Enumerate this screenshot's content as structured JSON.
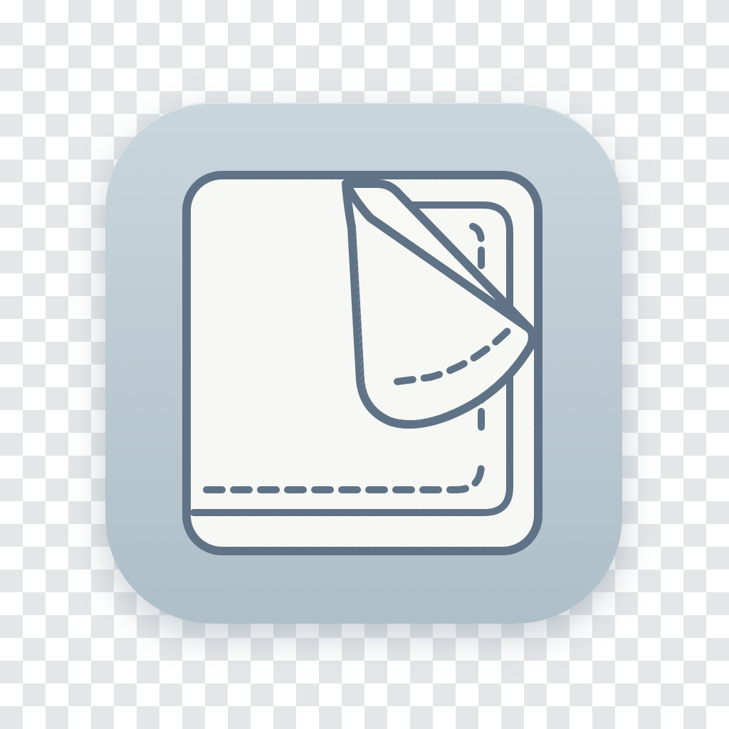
{
  "icon": {
    "name": "folded-towel-icon",
    "colors": {
      "tile_top": "#c9d6dc",
      "tile_bottom": "#aebfc9",
      "outline": "#5f7286",
      "fill": "#f8f9f5",
      "checker_light": "#ffffff",
      "checker_dark": "#e4e6e8"
    }
  }
}
